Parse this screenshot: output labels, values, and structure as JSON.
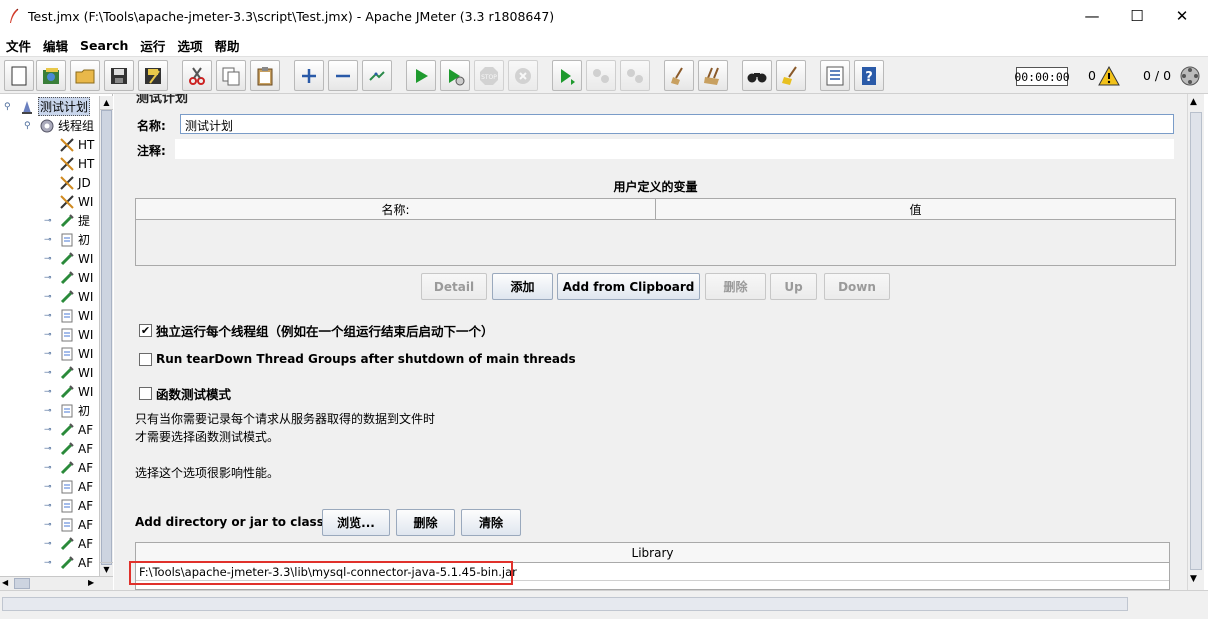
{
  "window": {
    "title": "Test.jmx (F:\\Tools\\apache-jmeter-3.3\\script\\Test.jmx) - Apache JMeter (3.3 r1808647)",
    "minimize": "—",
    "maximize": "☐",
    "close": "✕"
  },
  "menu": [
    "文件",
    "编辑",
    "Search",
    "运行",
    "选项",
    "帮助"
  ],
  "toolbar": {
    "timer": "00:00:00",
    "error_count": "0",
    "thread_count": "0 / 0"
  },
  "tree": {
    "items": [
      {
        "label": "测试计划",
        "icon": "test-plan-icon"
      },
      {
        "label": "线程组",
        "icon": "gear-icon"
      },
      {
        "label": "HT",
        "icon": "wrench-icon"
      },
      {
        "label": "HT",
        "icon": "wrench-icon"
      },
      {
        "label": "JD",
        "icon": "wrench-icon"
      },
      {
        "label": "WI",
        "icon": "wrench-icon"
      },
      {
        "label": "提",
        "icon": "pipette-icon"
      },
      {
        "label": "初",
        "icon": "doc-icon"
      },
      {
        "label": "WI",
        "icon": "pipette-icon"
      },
      {
        "label": "WI",
        "icon": "pipette-icon"
      },
      {
        "label": "WI",
        "icon": "pipette-icon"
      },
      {
        "label": "WI",
        "icon": "doc-icon"
      },
      {
        "label": "WI",
        "icon": "doc-icon"
      },
      {
        "label": "WI",
        "icon": "doc-icon"
      },
      {
        "label": "WI",
        "icon": "pipette-icon"
      },
      {
        "label": "WI",
        "icon": "pipette-icon"
      },
      {
        "label": "初",
        "icon": "doc-icon"
      },
      {
        "label": "AF",
        "icon": "pipette-icon"
      },
      {
        "label": "AF",
        "icon": "pipette-icon"
      },
      {
        "label": "AF",
        "icon": "pipette-icon"
      },
      {
        "label": "AF",
        "icon": "doc-icon"
      },
      {
        "label": "AF",
        "icon": "doc-icon"
      },
      {
        "label": "AF",
        "icon": "doc-icon"
      },
      {
        "label": "AF",
        "icon": "pipette-icon"
      },
      {
        "label": "AF",
        "icon": "pipette-icon"
      }
    ]
  },
  "main": {
    "section_title_partial": "测试计划",
    "name_label": "名称:",
    "name_value": "测试计划",
    "comment_label": "注释:",
    "comment_value": "",
    "udv_title": "用户定义的变量",
    "udv_columns": [
      "名称:",
      "值"
    ],
    "buttons": {
      "detail": "Detail",
      "add": "添加",
      "add_clipboard": "Add from Clipboard",
      "delete": "删除",
      "up": "Up",
      "down": "Down"
    },
    "options": {
      "serialize_label": "独立运行每个线程组（例如在一个组运行结束后启动下一个）",
      "serialize_checked": true,
      "teardown_label": "Run tearDown Thread Groups after shutdown of main threads",
      "teardown_checked": false,
      "functional_label": "函数测试模式",
      "functional_checked": false
    },
    "help_text": [
      "只有当你需要记录每个请求从服务器取得的数据到文件时",
      "才需要选择函数测试模式。",
      "选择这个选项很影响性能。"
    ],
    "classpath": {
      "label": "Add directory or jar to classpath",
      "browse": "浏览...",
      "delete": "删除",
      "clear": "清除",
      "column": "Library",
      "rows": [
        "F:\\Tools\\apache-jmeter-3.3\\lib\\mysql-connector-java-5.1.45-bin.jar"
      ]
    },
    "highlight_color": "#e0312b"
  }
}
